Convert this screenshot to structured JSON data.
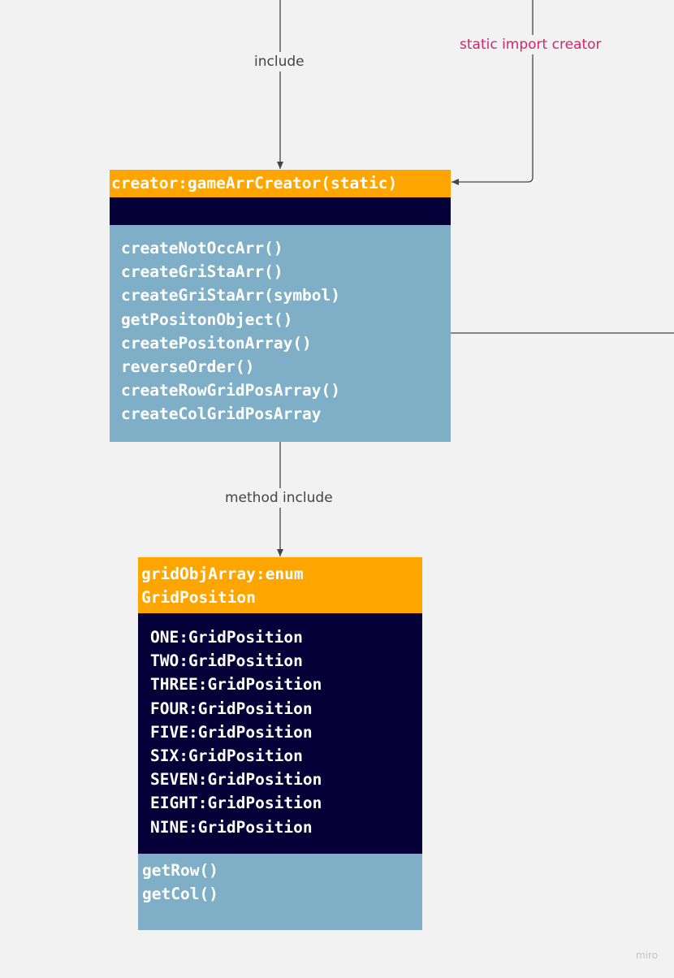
{
  "edges": {
    "include_label": "include",
    "static_import_label": "static import creator",
    "method_include_label": "method include"
  },
  "creator_box": {
    "header": "creator:gameArrCreator(static)",
    "methods": [
      "createNotOccArr()",
      "createGriStaArr()",
      "createGriStaArr(symbol)",
      "getPositonObject()",
      "createPositonArray()",
      "reverseOrder()",
      "createRowGridPosArray()",
      "createColGridPosArray"
    ]
  },
  "enum_box": {
    "header_line1": "gridObjArray:enum",
    "header_line2": "GridPosition",
    "constants": [
      "ONE:GridPosition",
      "TWO:GridPosition",
      "THREE:GridPosition",
      "FOUR:GridPosition",
      "FIVE:GridPosition",
      "SIX:GridPosition",
      "SEVEN:GridPosition",
      "EIGHT:GridPosition",
      "NINE:GridPosition"
    ],
    "methods": [
      "getRow()",
      "getCol()"
    ]
  },
  "watermark": "miro",
  "colors": {
    "background": "#f2f2f2",
    "header_orange": "#ffa500",
    "navy": "#050038",
    "method_blue": "#7fafc6",
    "edge_line": "#444444",
    "pink_label": "#d4246b"
  }
}
